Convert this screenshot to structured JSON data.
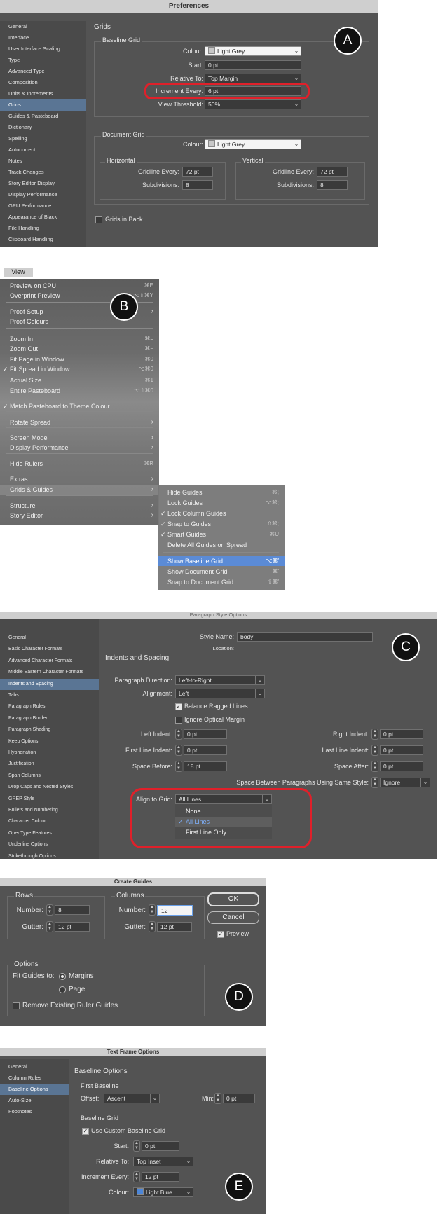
{
  "preferences": {
    "title": "Preferences",
    "sidebar": [
      "General",
      "Interface",
      "User Interface Scaling",
      "Type",
      "Advanced Type",
      "Composition",
      "Units & Increments",
      "Grids",
      "Guides & Pasteboard",
      "Dictionary",
      "Spelling",
      "Autocorrect",
      "Notes",
      "Track Changes",
      "Story Editor Display",
      "Display Performance",
      "GPU Performance",
      "Appearance of Black",
      "File Handling",
      "Clipboard Handling"
    ],
    "selected_index": 7,
    "section_title": "Grids",
    "baseline": {
      "title": "Baseline Grid",
      "colour_label": "Colour:",
      "colour_value": "Light Grey",
      "start_label": "Start:",
      "start_value": "0 pt",
      "relative_label": "Relative To:",
      "relative_value": "Top Margin",
      "increment_label": "Increment Every:",
      "increment_value": "6 pt",
      "threshold_label": "View Threshold:",
      "threshold_value": "50%"
    },
    "document": {
      "title": "Document Grid",
      "colour_label": "Colour:",
      "colour_value": "Light Grey",
      "horizontal": {
        "title": "Horizontal",
        "gridline_label": "Gridline Every:",
        "gridline_value": "72 pt",
        "subdiv_label": "Subdivisions:",
        "subdiv_value": "8"
      },
      "vertical": {
        "title": "Vertical",
        "gridline_label": "Gridline Every:",
        "gridline_value": "72 pt",
        "subdiv_label": "Subdivisions:",
        "subdiv_value": "8"
      }
    },
    "grids_in_back": "Grids in Back",
    "badge": "A"
  },
  "view_menu": {
    "title": "View",
    "badge": "B",
    "items": [
      {
        "label": "Preview on CPU",
        "shortcut": "⌘E"
      },
      {
        "label": "Overprint Preview",
        "shortcut": "⌥⇧⌘Y"
      },
      {
        "label": "Proof Setup",
        "arrow": "›"
      },
      {
        "label": "Proof Colours"
      },
      {
        "label": "Zoom In",
        "shortcut": "⌘="
      },
      {
        "label": "Zoom Out",
        "shortcut": "⌘−"
      },
      {
        "label": "Fit Page in Window",
        "shortcut": "⌘0"
      },
      {
        "label": "Fit Spread in Window",
        "shortcut": "⌥⌘0",
        "check": "✓"
      },
      {
        "label": "Actual Size",
        "shortcut": "⌘1"
      },
      {
        "label": "Entire Pasteboard",
        "shortcut": "⌥⇧⌘0"
      },
      {
        "label": "Match Pasteboard to Theme Colour",
        "check": "✓"
      },
      {
        "label": "Rotate Spread",
        "arrow": "›"
      },
      {
        "label": "Screen Mode",
        "arrow": "›"
      },
      {
        "label": "Display Performance",
        "arrow": "›"
      },
      {
        "label": "Hide Rulers",
        "shortcut": "⌘R"
      },
      {
        "label": "Extras",
        "arrow": "›"
      },
      {
        "label": "Grids & Guides",
        "arrow": "›"
      },
      {
        "label": "Structure",
        "arrow": "›"
      },
      {
        "label": "Story Editor",
        "arrow": "›"
      }
    ],
    "submenu": [
      {
        "label": "Hide Guides",
        "shortcut": "⌘;"
      },
      {
        "label": "Lock Guides",
        "shortcut": "⌥⌘;"
      },
      {
        "label": "Lock Column Guides",
        "check": "✓"
      },
      {
        "label": "Snap to Guides",
        "shortcut": "⇧⌘;",
        "check": "✓"
      },
      {
        "label": "Smart Guides",
        "shortcut": "⌘U",
        "check": "✓"
      },
      {
        "label": "Delete All Guides on Spread"
      },
      {
        "label": "Show Baseline Grid",
        "shortcut": "⌥⌘'"
      },
      {
        "label": "Show Document Grid",
        "shortcut": "⌘'"
      },
      {
        "label": "Snap to Document Grid",
        "shortcut": "⇧⌘'"
      }
    ]
  },
  "paragraph_style": {
    "title": "Paragraph Style Options",
    "badge": "C",
    "sidebar": [
      "General",
      "Basic Character Formats",
      "Advanced Character Formats",
      "Middle Eastern Character Formats",
      "Indents and Spacing",
      "Tabs",
      "Paragraph Rules",
      "Paragraph Border",
      "Paragraph Shading",
      "Keep Options",
      "Hyphenation",
      "Justification",
      "Span Columns",
      "Drop Caps and Nested Styles",
      "GREP Style",
      "Bullets and Numbering",
      "Character Colour",
      "OpenType Features",
      "Underline Options",
      "Strikethrough Options"
    ],
    "selected_index": 4,
    "style_name_label": "Style Name:",
    "style_name_value": "body",
    "location_label": "Location:",
    "section_title": "Indents and Spacing",
    "direction_label": "Paragraph Direction:",
    "direction_value": "Left-to-Right",
    "alignment_label": "Alignment:",
    "alignment_value": "Left",
    "balance_label": "Balance Ragged Lines",
    "ignore_label": "Ignore Optical Margin",
    "left_indent_label": "Left Indent:",
    "left_indent_value": "0 pt",
    "right_indent_label": "Right Indent:",
    "right_indent_value": "0 pt",
    "first_line_label": "First Line Indent:",
    "first_line_value": "0 pt",
    "last_line_label": "Last Line Indent:",
    "last_line_value": "0 pt",
    "space_before_label": "Space Before:",
    "space_before_value": "18 pt",
    "space_after_label": "Space After:",
    "space_after_value": "0 pt",
    "same_style_label": "Space Between Paragraphs Using Same Style:",
    "same_style_value": "Ignore",
    "align_grid_label": "Align to Grid:",
    "align_grid_value": "All Lines",
    "align_options": [
      "None",
      "All Lines",
      "First Line Only"
    ],
    "align_selected": 1,
    "check_mark": "✓"
  },
  "create_guides": {
    "title": "Create Guides",
    "badge": "D",
    "rows_title": "Rows",
    "rows_number_label": "Number:",
    "rows_number_value": "8",
    "rows_gutter_label": "Gutter:",
    "rows_gutter_value": "12 pt",
    "cols_title": "Columns",
    "cols_number_label": "Number:",
    "cols_number_value": "12",
    "cols_gutter_label": "Gutter:",
    "cols_gutter_value": "12 pt",
    "ok": "OK",
    "cancel": "Cancel",
    "preview": "Preview",
    "options_title": "Options",
    "fit_label": "Fit Guides to:",
    "margins": "Margins",
    "page": "Page",
    "remove_label": "Remove Existing Ruler Guides"
  },
  "text_frame": {
    "title": "Text Frame Options",
    "badge": "E",
    "sidebar": [
      "General",
      "Column Rules",
      "Baseline Options",
      "Auto-Size",
      "Footnotes"
    ],
    "selected_index": 2,
    "section_title": "Baseline Options",
    "first_baseline_title": "First Baseline",
    "offset_label": "Offset:",
    "offset_value": "Ascent",
    "min_label": "Min:",
    "min_value": "0 pt",
    "grid_title": "Baseline Grid",
    "custom_label": "Use Custom Baseline Grid",
    "start_label": "Start:",
    "start_value": "0 pt",
    "relative_label": "Relative To:",
    "relative_value": "Top Inset",
    "increment_label": "Increment Every:",
    "increment_value": "12 pt",
    "colour_label": "Colour:",
    "colour_value": "Light Blue"
  },
  "colors": {
    "accent": "#5b8bd6",
    "highlight_red": "#e0202a",
    "panel": "#535353"
  }
}
